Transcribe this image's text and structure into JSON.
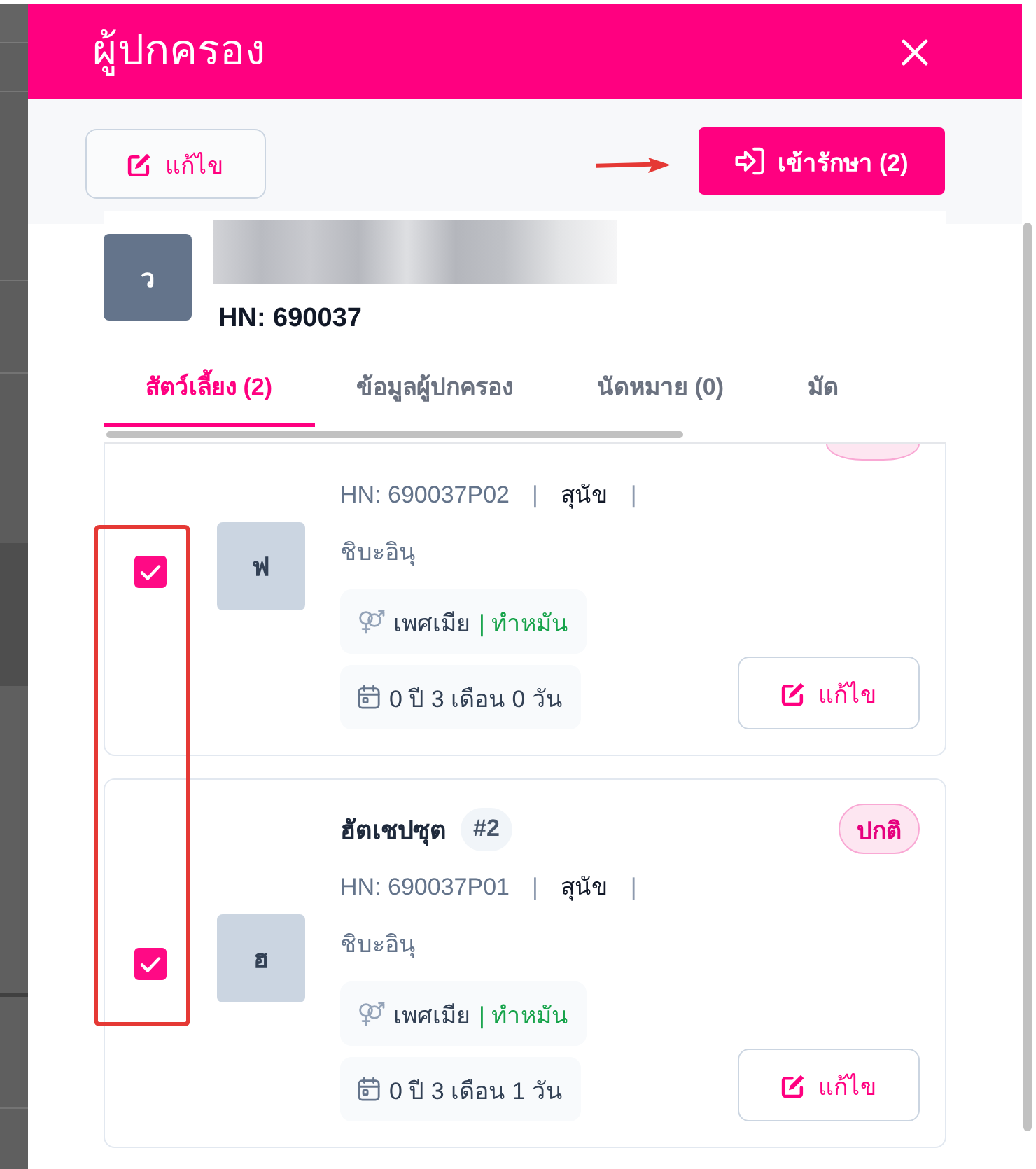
{
  "dialog": {
    "title": "ผู้ปกครอง"
  },
  "toolbar": {
    "edit_button": "แก้ไข",
    "admit_button": "เข้ารักษา (2)"
  },
  "owner": {
    "initial": "ว",
    "name_blurred": true,
    "hn": "HN: 690037"
  },
  "tabs": [
    {
      "label": "สัตว์เลี้ยง (2)",
      "selected": true
    },
    {
      "label": "ข้อมูลผู้ปกครอง",
      "selected": false
    },
    {
      "label": "นัดหมาย (0)",
      "selected": false
    },
    {
      "label": "มัด",
      "selected": false
    }
  ],
  "pets": [
    {
      "cut_off_top": true,
      "selected": true,
      "initial": "ฟ",
      "info": [
        {
          "kind": "hn",
          "text": "HN: 690037P02"
        },
        {
          "kind": "separator",
          "text": "|"
        },
        {
          "kind": "species",
          "text": "สุนัข"
        },
        {
          "kind": "separator",
          "text": "|"
        }
      ],
      "breed": "ชิบะอินุ",
      "sex": "เพศเมีย",
      "neutered": "| ทำหมัน",
      "age": "0 ปี 3 เดือน 0 วัน",
      "edit_button": "แก้ไข"
    },
    {
      "cut_off_top": false,
      "selected": true,
      "name": "ฮัตเชปซุต",
      "number": "#2",
      "status": "ปกติ",
      "initial": "ฮ",
      "info": [
        {
          "kind": "hn",
          "text": "HN: 690037P01"
        },
        {
          "kind": "separator",
          "text": "|"
        },
        {
          "kind": "species",
          "text": "สุนัข"
        },
        {
          "kind": "separator",
          "text": "|"
        }
      ],
      "breed": "ชิบะอินุ",
      "sex": "เพศเมีย",
      "neutered": "| ทำหมัน",
      "age": "0 ปี 3 เดือน 1 วัน",
      "edit_button": "แก้ไข"
    }
  ]
}
